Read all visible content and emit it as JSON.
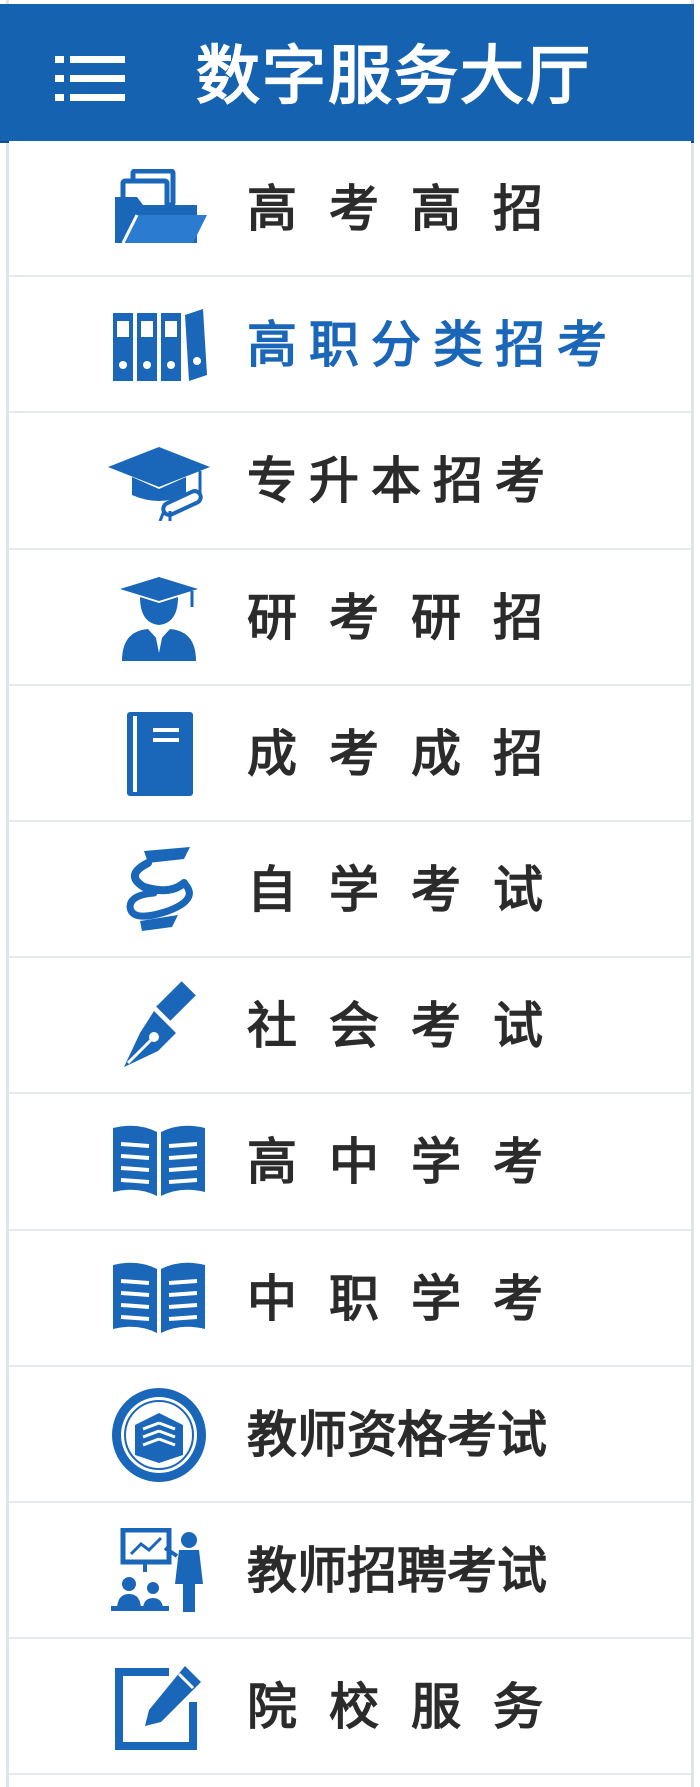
{
  "header": {
    "title": "数字服务大厅"
  },
  "colors": {
    "brand": "#1562b1",
    "active_text": "#1a66b8",
    "text": "#2b2b2b",
    "divider": "#e6e9f0"
  },
  "menu": [
    {
      "label": "高考高招",
      "icon": "folder-documents-icon"
    },
    {
      "label": "高职分类招考",
      "icon": "binders-icon",
      "active": true
    },
    {
      "label": "专升本招考",
      "icon": "graduation-cap-diploma-icon"
    },
    {
      "label": "研考研招",
      "icon": "graduate-person-icon"
    },
    {
      "label": "成考成招",
      "icon": "notebook-icon"
    },
    {
      "label": "自学考试",
      "icon": "self-study-swirl-icon"
    },
    {
      "label": "社会考试",
      "icon": "fountain-pen-icon"
    },
    {
      "label": "高中学考",
      "icon": "open-book-icon"
    },
    {
      "label": "中职学考",
      "icon": "open-book-icon"
    },
    {
      "label": "教师资格考试",
      "icon": "teacher-seal-emblem-icon"
    },
    {
      "label": "教师招聘考试",
      "icon": "teacher-classroom-icon"
    },
    {
      "label": "院校服务",
      "icon": "edit-document-icon"
    }
  ]
}
